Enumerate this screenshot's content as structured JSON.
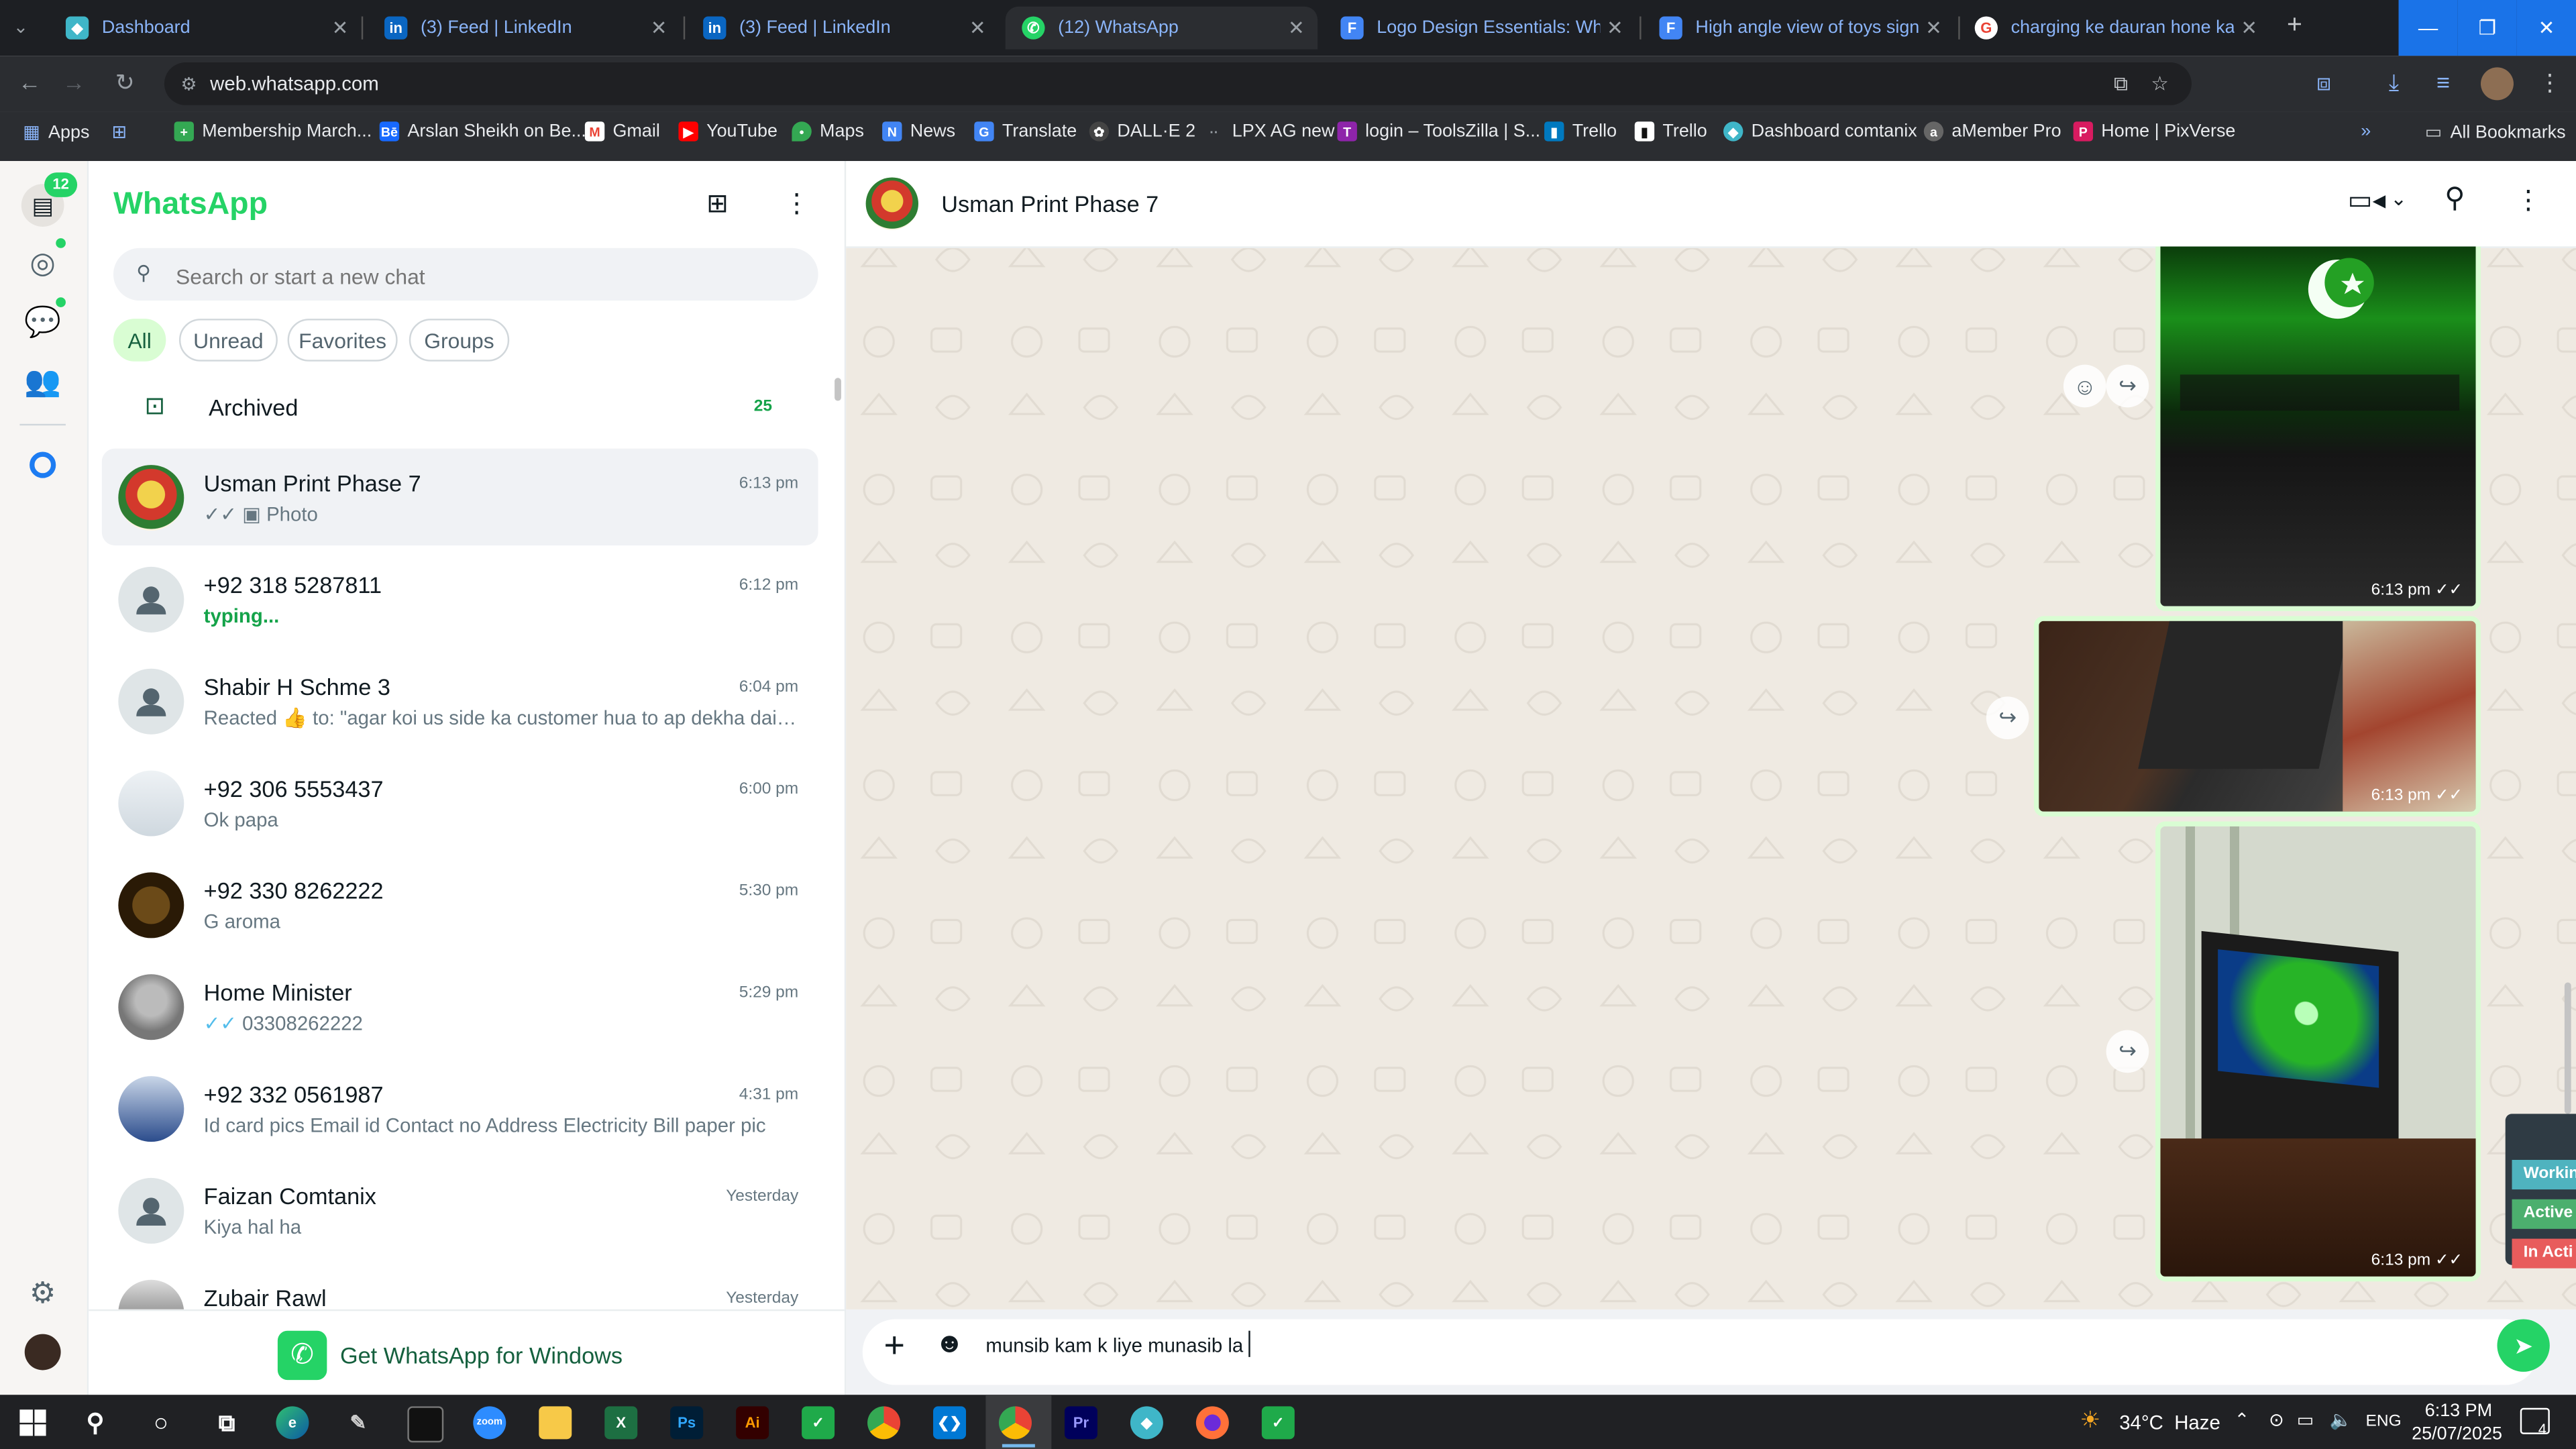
{
  "browser": {
    "tabs": [
      {
        "title": "Dashboard",
        "icon": "dashboard-icon",
        "color": "#3fb6c8"
      },
      {
        "title": "(3) Feed | LinkedIn",
        "icon": "linkedin-icon",
        "color": "#0a66c2"
      },
      {
        "title": "(3) Feed | LinkedIn",
        "icon": "linkedin-icon",
        "color": "#0a66c2"
      },
      {
        "title": "(12) WhatsApp",
        "icon": "whatsapp-icon",
        "color": "#25d366"
      },
      {
        "title": "Logo Design Essentials: What Every...",
        "icon": "document-icon",
        "color": "#4285f4"
      },
      {
        "title": "High angle view of toys sign | Fre...",
        "icon": "document-icon",
        "color": "#4285f4"
      },
      {
        "title": "charging ke dauran hone ka use...",
        "icon": "google-icon",
        "color": "#ea4335"
      }
    ],
    "url": "web.whatsapp.com",
    "bookmarks": [
      {
        "label": "Apps",
        "icon": "apps-grid-icon"
      },
      {
        "label": "",
        "icon": "app-grid-icon"
      },
      {
        "label": "Membership March...",
        "icon": "bookmark-icon"
      },
      {
        "label": "Arslan Sheikh on Be...",
        "icon": "behance-icon"
      },
      {
        "label": "Gmail",
        "icon": "gmail-icon"
      },
      {
        "label": "YouTube",
        "icon": "youtube-icon"
      },
      {
        "label": "Maps",
        "icon": "maps-icon"
      },
      {
        "label": "News",
        "icon": "news-icon"
      },
      {
        "label": "Translate",
        "icon": "translate-icon"
      },
      {
        "label": "DALL·E 2",
        "icon": "openai-icon"
      },
      {
        "label": "LPX AG new",
        "icon": "link-icon"
      },
      {
        "label": "login – ToolsZilla | S...",
        "icon": "tools-icon"
      },
      {
        "label": "Trello",
        "icon": "trello-icon"
      },
      {
        "label": "Trello",
        "icon": "trello-icon"
      },
      {
        "label": "Dashboard comtanix",
        "icon": "dashboard-icon"
      },
      {
        "label": "aMember Pro",
        "icon": "amember-icon"
      },
      {
        "label": "Home | PixVerse",
        "icon": "pixverse-icon"
      }
    ],
    "all_bookmarks": "All Bookmarks"
  },
  "whatsapp": {
    "title": "WhatsApp",
    "unread_badge": "12",
    "search_placeholder": "Search or start a new chat",
    "filters": [
      "All",
      "Unread",
      "Favorites",
      "Groups"
    ],
    "archived_label": "Archived",
    "archived_count": "25",
    "chats": [
      {
        "name": "Usman Print Phase 7",
        "time": "6:13 pm",
        "preview": "Photo"
      },
      {
        "name": "+92 318 5287811",
        "time": "6:12 pm",
        "preview": "typing..."
      },
      {
        "name": "Shabir H  Schme 3",
        "time": "6:04 pm",
        "preview": "Reacted 👍 to: \"agar koi  us side ka customer hua to ap dekha daina..."
      },
      {
        "name": "+92 306 5553437",
        "time": "6:00 pm",
        "preview": "Ok papa"
      },
      {
        "name": "+92 330 8262222",
        "time": "5:30 pm",
        "preview": "G aroma"
      },
      {
        "name": "Home Minister",
        "time": "5:29 pm",
        "preview": "03308262222"
      },
      {
        "name": "+92 332 0561987",
        "time": "4:31 pm",
        "preview": "Id card pics Email id  Contact no Address Electricity Bill paper pic"
      },
      {
        "name": "Faizan Comtanix",
        "time": "Yesterday",
        "preview": "Kiya hal ha"
      },
      {
        "name": "Zubair Rawl",
        "time": "Yesterday",
        "preview": ""
      }
    ],
    "get_app": "Get WhatsApp for Windows",
    "conversation": {
      "contact": "Usman Print Phase 7",
      "messages": [
        {
          "type": "image",
          "time": "6:13 pm"
        },
        {
          "type": "image",
          "time": "6:13 pm"
        },
        {
          "type": "image",
          "time": "6:13 pm"
        }
      ],
      "composer_text": "munsib kam k liye munasib la"
    },
    "side_tabs": [
      "Workin",
      "Active",
      "In Acti"
    ]
  },
  "taskbar": {
    "weather": "34°C  Haze",
    "lang": "ENG",
    "time": "6:13 PM",
    "date": "25/07/2025",
    "notifications": "4"
  }
}
